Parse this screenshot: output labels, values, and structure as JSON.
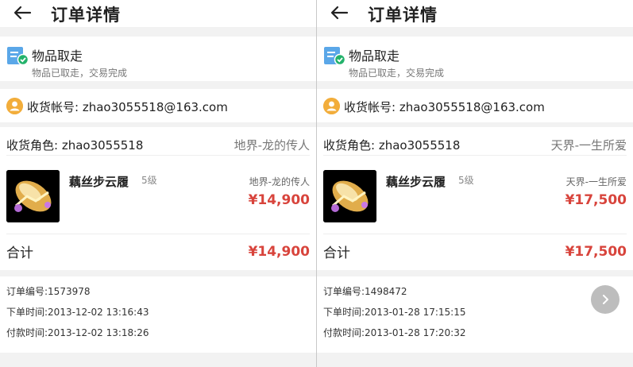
{
  "panels": [
    {
      "header_title": "订单详情",
      "status": {
        "title": "物品取走",
        "subtitle": "物品已取走，交易完成"
      },
      "account": {
        "label": "收货帐号:",
        "value": "zhao3055518@163.com"
      },
      "role": {
        "label": "收货角色:",
        "value": "zhao3055518",
        "server": "地界-龙的传人"
      },
      "item": {
        "name": "藕丝步云履",
        "level": "5级",
        "server": "地界-龙的传人",
        "price": "¥14,900"
      },
      "total": {
        "label": "合计",
        "value": "¥14,900"
      },
      "order_info": {
        "order_no": "订单编号:1573978",
        "order_time": "下单时间:2013-12-02 13:16:43",
        "pay_time": "付款时间:2013-12-02 13:18:26"
      }
    },
    {
      "header_title": "订单详情",
      "status": {
        "title": "物品取走",
        "subtitle": "物品已取走，交易完成"
      },
      "account": {
        "label": "收货帐号:",
        "value": "zhao3055518@163.com"
      },
      "role": {
        "label": "收货角色:",
        "value": "zhao3055518",
        "server": "天界-一生所爱"
      },
      "item": {
        "name": "藕丝步云履",
        "level": "5级",
        "server": "天界-一生所爱",
        "price": "¥17,500"
      },
      "total": {
        "label": "合计",
        "value": "¥17,500"
      },
      "order_info": {
        "order_no": "订单编号:1498472",
        "order_time": "下单时间:2013-01-28 17:15:15",
        "pay_time": "付款时间:2013-01-28 17:20:32"
      }
    }
  ],
  "icons": {
    "back": "back-arrow-icon",
    "status": "receipt-check-icon",
    "account": "user-avatar-icon",
    "next": "chevron-right-icon"
  },
  "colors": {
    "price": "#d8443c",
    "avatar": "#f2ad3b",
    "status_icon": "#5aa7e8",
    "check": "#23b26b"
  }
}
